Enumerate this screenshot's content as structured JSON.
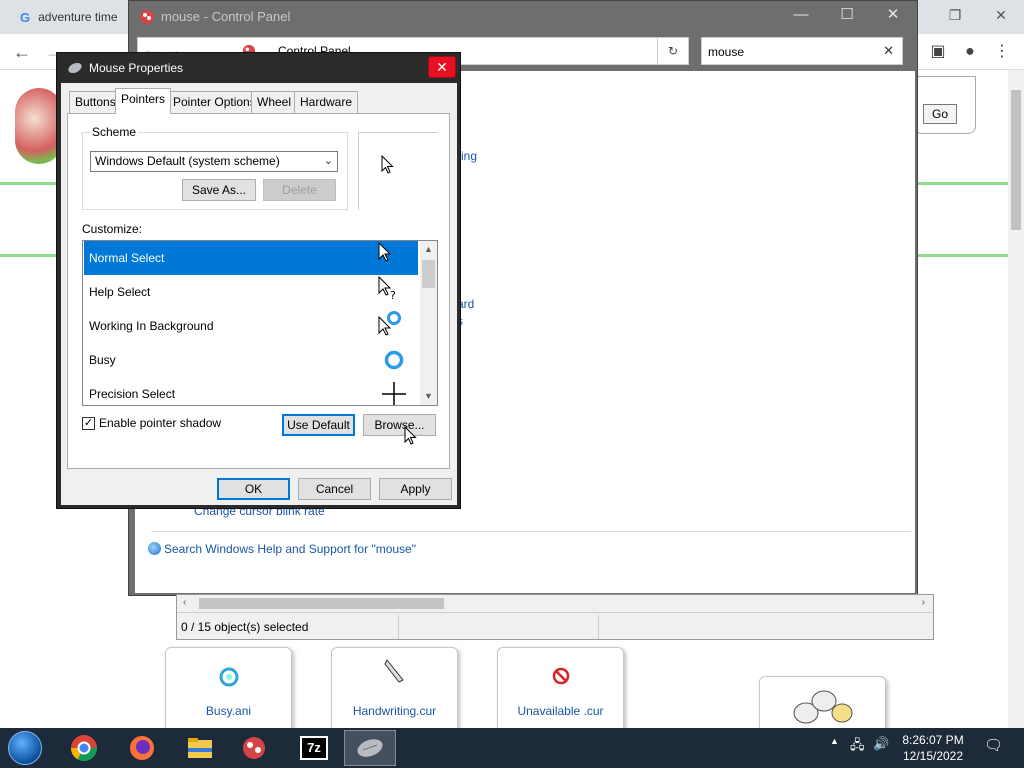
{
  "browser": {
    "tab_title": "adventure time",
    "go_label": "Go"
  },
  "control_panel": {
    "title": "mouse - Control Panel",
    "address": "Control Panel",
    "search_value": "mouse",
    "links": {
      "partial_1": "ving",
      "partial_2": "ard",
      "partial_3": "s",
      "blink_rate": "Change cursor blink rate",
      "help_search": "Search Windows Help and Support for \"mouse\""
    }
  },
  "explorer": {
    "status": "0 / 15 object(s) selected"
  },
  "file_tiles": [
    {
      "name": "Busy.ani"
    },
    {
      "name": "Handwriting.cur"
    },
    {
      "name": "Unavailable .cur"
    }
  ],
  "dialog": {
    "title": "Mouse Properties",
    "tabs": [
      "Buttons",
      "Pointers",
      "Pointer Options",
      "Wheel",
      "Hardware"
    ],
    "active_tab": "Pointers",
    "scheme_label": "Scheme",
    "scheme_value": "Windows Default (system scheme)",
    "save_as_label": "Save As...",
    "delete_label": "Delete",
    "customize_label": "Customize:",
    "pointer_list": [
      {
        "label": "Normal Select",
        "icon": "arrow-cursor-icon",
        "selected": true
      },
      {
        "label": "Help Select",
        "icon": "help-cursor-icon",
        "selected": false
      },
      {
        "label": "Working In Background",
        "icon": "working-cursor-icon",
        "selected": false
      },
      {
        "label": "Busy",
        "icon": "busy-cursor-icon",
        "selected": false
      },
      {
        "label": "Precision Select",
        "icon": "crosshair-cursor-icon",
        "selected": false
      }
    ],
    "enable_shadow_label": "Enable pointer shadow",
    "enable_shadow_checked": true,
    "use_default_label": "Use Default",
    "browse_label": "Browse...",
    "ok_label": "OK",
    "cancel_label": "Cancel",
    "apply_label": "Apply"
  },
  "taskbar": {
    "time": "8:26:07 PM",
    "date": "12/15/2022"
  }
}
